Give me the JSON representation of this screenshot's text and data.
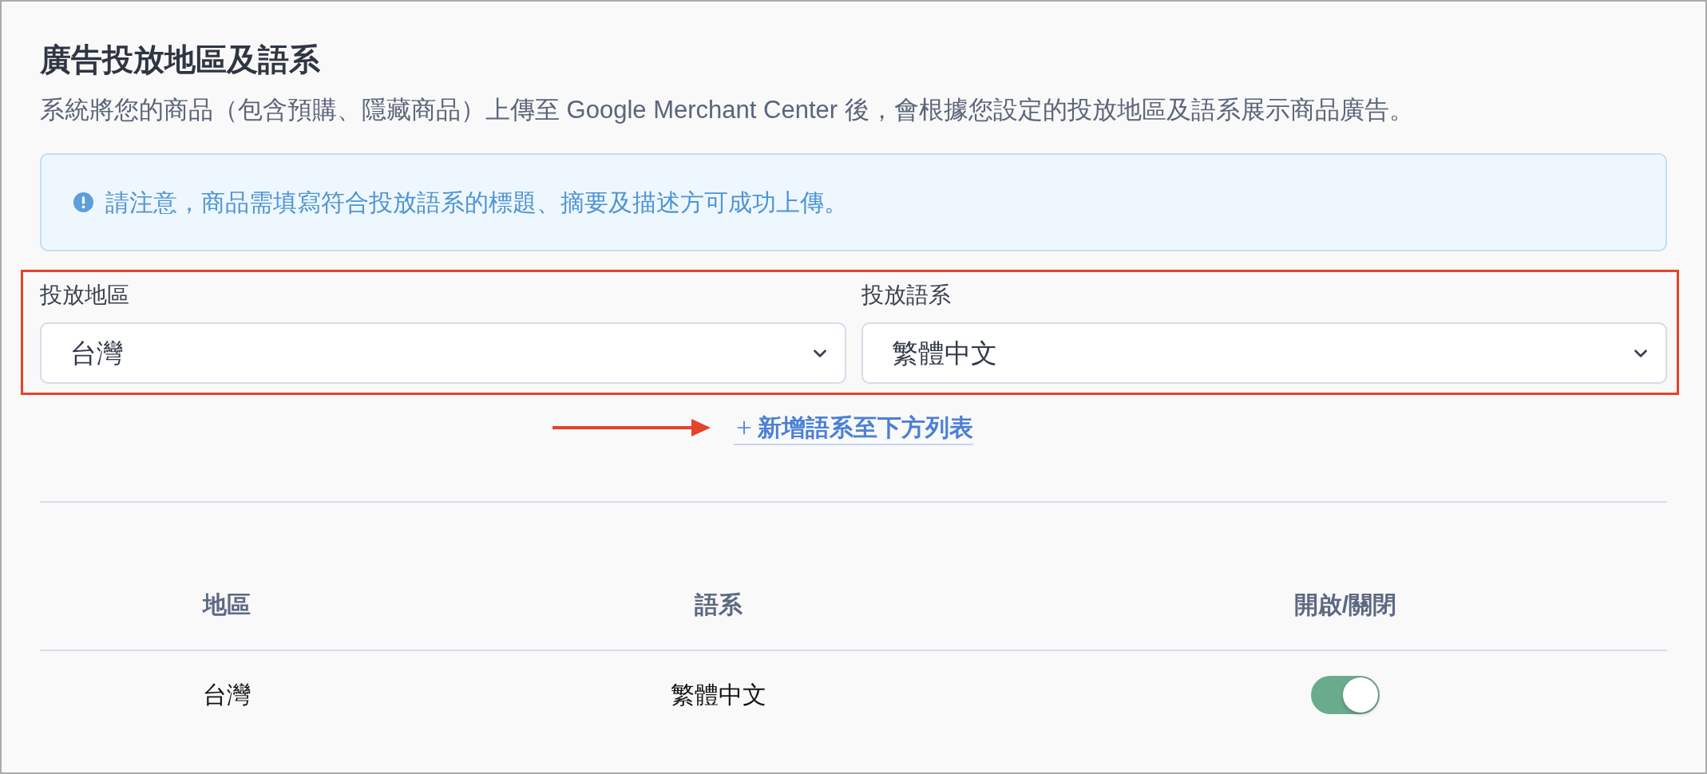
{
  "section": {
    "title": "廣告投放地區及語系",
    "description": "系統將您的商品（包含預購、隱藏商品）上傳至 Google Merchant Center 後，會根據您設定的投放地區及語系展示商品廣告。"
  },
  "notice": {
    "text": "請注意，商品需填寫符合投放語系的標題、摘要及描述方可成功上傳。"
  },
  "selects": [
    {
      "label": "投放地區",
      "value": "台灣"
    },
    {
      "label": "投放語系",
      "value": "繁體中文"
    }
  ],
  "add_link": {
    "label": "新增語系至下方列表"
  },
  "table": {
    "columns": [
      "地區",
      "語系",
      "開啟/關閉"
    ],
    "rows": [
      {
        "region": "台灣",
        "language": "繁體中文",
        "enabled": true
      }
    ]
  }
}
